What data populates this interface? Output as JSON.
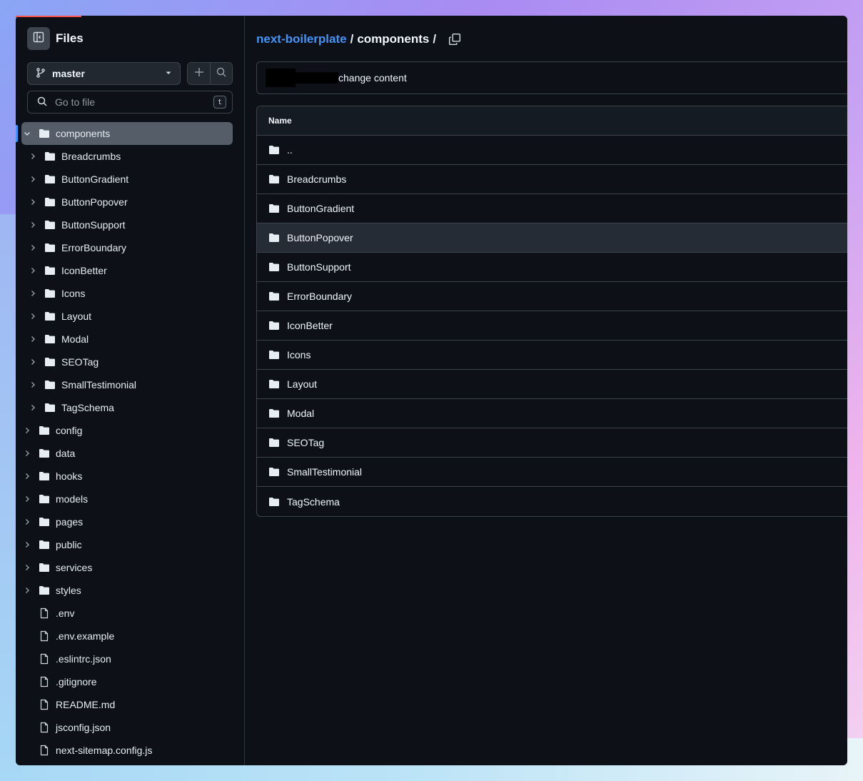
{
  "sidebar": {
    "title": "Files",
    "branch": "master",
    "goto_placeholder": "Go to file",
    "goto_shortcut": "t",
    "tree": [
      {
        "name": "components",
        "type": "folder",
        "level": 0,
        "expanded": true,
        "selected": true
      },
      {
        "name": "Breadcrumbs",
        "type": "folder",
        "level": 1
      },
      {
        "name": "ButtonGradient",
        "type": "folder",
        "level": 1
      },
      {
        "name": "ButtonPopover",
        "type": "folder",
        "level": 1
      },
      {
        "name": "ButtonSupport",
        "type": "folder",
        "level": 1
      },
      {
        "name": "ErrorBoundary",
        "type": "folder",
        "level": 1
      },
      {
        "name": "IconBetter",
        "type": "folder",
        "level": 1
      },
      {
        "name": "Icons",
        "type": "folder",
        "level": 1
      },
      {
        "name": "Layout",
        "type": "folder",
        "level": 1
      },
      {
        "name": "Modal",
        "type": "folder",
        "level": 1
      },
      {
        "name": "SEOTag",
        "type": "folder",
        "level": 1
      },
      {
        "name": "SmallTestimonial",
        "type": "folder",
        "level": 1
      },
      {
        "name": "TagSchema",
        "type": "folder",
        "level": 1
      },
      {
        "name": "config",
        "type": "folder",
        "level": 0
      },
      {
        "name": "data",
        "type": "folder",
        "level": 0
      },
      {
        "name": "hooks",
        "type": "folder",
        "level": 0
      },
      {
        "name": "models",
        "type": "folder",
        "level": 0
      },
      {
        "name": "pages",
        "type": "folder",
        "level": 0
      },
      {
        "name": "public",
        "type": "folder",
        "level": 0
      },
      {
        "name": "services",
        "type": "folder",
        "level": 0
      },
      {
        "name": "styles",
        "type": "folder",
        "level": 0
      },
      {
        "name": ".env",
        "type": "file",
        "level": 0
      },
      {
        "name": ".env.example",
        "type": "file",
        "level": 0
      },
      {
        "name": ".eslintrc.json",
        "type": "file",
        "level": 0
      },
      {
        "name": ".gitignore",
        "type": "file",
        "level": 0
      },
      {
        "name": "README.md",
        "type": "file",
        "level": 0
      },
      {
        "name": "jsconfig.json",
        "type": "file",
        "level": 0
      },
      {
        "name": "next-sitemap.config.js",
        "type": "file",
        "level": 0
      }
    ]
  },
  "main": {
    "breadcrumb": {
      "repo": "next-boilerplate",
      "separator": "/",
      "current": "components",
      "trailing": "/"
    },
    "commit_message": "change content",
    "table": {
      "header": "Name",
      "rows": [
        "..",
        "Breadcrumbs",
        "ButtonGradient",
        "ButtonPopover",
        "ButtonSupport",
        "ErrorBoundary",
        "IconBetter",
        "Icons",
        "Layout",
        "Modal",
        "SEOTag",
        "SmallTestimonial",
        "TagSchema"
      ],
      "hover_row": 3
    }
  },
  "colors": {
    "accent": "#4493f8",
    "bg": "#0d1117",
    "border": "#3d444d",
    "selected": "#545d68"
  }
}
